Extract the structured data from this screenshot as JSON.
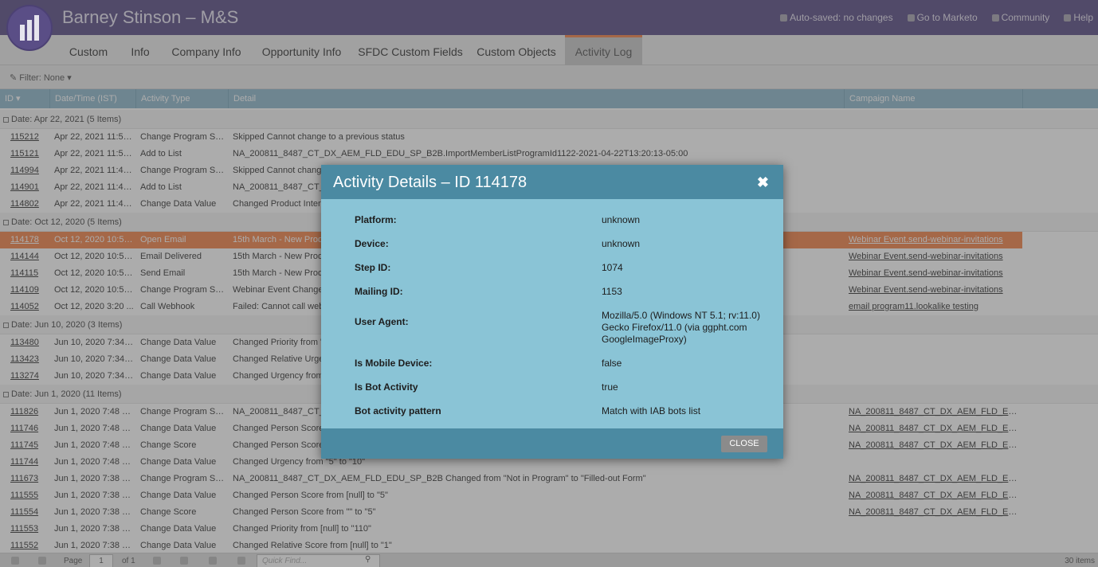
{
  "header": {
    "title": "Barney Stinson – M&S",
    "links": [
      "Auto-saved: no changes",
      "Go to Marketo",
      "Community",
      "Help"
    ]
  },
  "tabs": [
    "Custom",
    "Info",
    "Company Info",
    "Opportunity Info",
    "SFDC Custom Fields",
    "Custom Objects",
    "Activity Log"
  ],
  "active_tab": "Activity Log",
  "filter": "Filter: None",
  "grid": {
    "columns": [
      "ID",
      "Date/Time (IST)",
      "Activity Type",
      "Detail",
      "Campaign Name"
    ],
    "groups": [
      {
        "label": "Date: Apr 22, 2021 (5 Items)",
        "rows": [
          {
            "id": "115212",
            "dt": "Apr 22, 2021 11:50...",
            "type": "Change Program Sta...",
            "detail": "Skipped Cannot change to a previous status",
            "campaign": ""
          },
          {
            "id": "115121",
            "dt": "Apr 22, 2021 11:50...",
            "type": "Add to List",
            "detail": "NA_200811_8487_CT_DX_AEM_FLD_EDU_SP_B2B.ImportMemberListProgramId1122-2021-04-22T13:20:13-05:00",
            "campaign": ""
          },
          {
            "id": "114994",
            "dt": "Apr 22, 2021 11:45...",
            "type": "Change Program Sta...",
            "detail": "Skipped Cannot change",
            "campaign": ""
          },
          {
            "id": "114901",
            "dt": "Apr 22, 2021 11:45...",
            "type": "Add to List",
            "detail": "NA_200811_8487_CT_DX",
            "campaign": ""
          },
          {
            "id": "114802",
            "dt": "Apr 22, 2021 11:45...",
            "type": "Change Data Value",
            "detail": "Changed Product Intere",
            "campaign": ""
          }
        ]
      },
      {
        "label": "Date: Oct 12, 2020 (5 Items)",
        "rows": [
          {
            "id": "114178",
            "dt": "Oct 12, 2020 10:53...",
            "type": "Open Email",
            "detail": "15th March - New Prod",
            "campaign": "Webinar Event.send-webinar-invitations",
            "highlight": true
          },
          {
            "id": "114144",
            "dt": "Oct 12, 2020 10:52...",
            "type": "Email Delivered",
            "detail": "15th March - New Produ",
            "campaign": "Webinar Event.send-webinar-invitations"
          },
          {
            "id": "114115",
            "dt": "Oct 12, 2020 10:52...",
            "type": "Send Email",
            "detail": "15th March - New Produ",
            "campaign": "Webinar Event.send-webinar-invitations"
          },
          {
            "id": "114109",
            "dt": "Oct 12, 2020 10:52...",
            "type": "Change Program Sta...",
            "detail": "Webinar Event Changed",
            "campaign": "Webinar Event.send-webinar-invitations"
          },
          {
            "id": "114052",
            "dt": "Oct 12, 2020 3:20 ...",
            "type": "Call Webhook",
            "detail": "Failed: Cannot call webh",
            "campaign": "email program11.lookalike testing"
          }
        ]
      },
      {
        "label": "Date: Jun 10, 2020 (3 Items)",
        "rows": [
          {
            "id": "113480",
            "dt": "Jun 10, 2020 7:34 ...",
            "type": "Change Data Value",
            "detail": "Changed Priority from \"",
            "campaign": ""
          },
          {
            "id": "113423",
            "dt": "Jun 10, 2020 7:34 ...",
            "type": "Change Data Value",
            "detail": "Changed Relative Urgen",
            "campaign": ""
          },
          {
            "id": "113274",
            "dt": "Jun 10, 2020 7:34 ...",
            "type": "Change Data Value",
            "detail": "Changed Urgency from",
            "campaign": ""
          }
        ]
      },
      {
        "label": "Date: Jun 1, 2020 (11 Items)",
        "rows": [
          {
            "id": "111826",
            "dt": "Jun 1, 2020 7:48 PM",
            "type": "Change Program Sta...",
            "detail": "NA_200811_8487_CT_DX",
            "campaign": "NA_200811_8487_CT_DX_AEM_FLD_EDU_SP..."
          },
          {
            "id": "111746",
            "dt": "Jun 1, 2020 7:48 PM",
            "type": "Change Data Value",
            "detail": "Changed Person Score f",
            "campaign": "NA_200811_8487_CT_DX_AEM_FLD_EDU_SP..."
          },
          {
            "id": "111745",
            "dt": "Jun 1, 2020 7:48 PM",
            "type": "Change Score",
            "detail": "Changed Person Score f",
            "campaign": "NA_200811_8487_CT_DX_AEM_FLD_EDU_SP..."
          },
          {
            "id": "111744",
            "dt": "Jun 1, 2020 7:48 PM",
            "type": "Change Data Value",
            "detail": "Changed Urgency from \"5\" to \"10\"",
            "campaign": ""
          },
          {
            "id": "111673",
            "dt": "Jun 1, 2020 7:38 PM",
            "type": "Change Program Sta...",
            "detail": "NA_200811_8487_CT_DX_AEM_FLD_EDU_SP_B2B Changed from \"Not in Program\" to \"Filled-out Form\"",
            "campaign": "NA_200811_8487_CT_DX_AEM_FLD_EDU_SP..."
          },
          {
            "id": "111555",
            "dt": "Jun 1, 2020 7:38 PM",
            "type": "Change Data Value",
            "detail": "Changed Person Score from [null] to \"5\"",
            "campaign": "NA_200811_8487_CT_DX_AEM_FLD_EDU_SP..."
          },
          {
            "id": "111554",
            "dt": "Jun 1, 2020 7:38 PM",
            "type": "Change Score",
            "detail": "Changed Person Score from \"\" to \"5\"",
            "campaign": "NA_200811_8487_CT_DX_AEM_FLD_EDU_SP..."
          },
          {
            "id": "111553",
            "dt": "Jun 1, 2020 7:38 PM",
            "type": "Change Data Value",
            "detail": "Changed Priority from [null] to \"110\"",
            "campaign": ""
          },
          {
            "id": "111552",
            "dt": "Jun 1, 2020 7:38 PM",
            "type": "Change Data Value",
            "detail": "Changed Relative Score from [null] to \"1\"",
            "campaign": ""
          }
        ]
      }
    ]
  },
  "footer": {
    "page_label": "Page",
    "page_value": "1",
    "of_label": "of 1",
    "quick_find_placeholder": "Quick Find...",
    "items_count": "30 items"
  },
  "modal": {
    "title": "Activity Details – ID 114178",
    "fields": [
      {
        "key": "Platform:",
        "value": "unknown"
      },
      {
        "key": "Device:",
        "value": "unknown"
      },
      {
        "key": "Step ID:",
        "value": "1074"
      },
      {
        "key": "Mailing ID:",
        "value": "1153"
      },
      {
        "key": "User Agent:",
        "value": "Mozilla/5.0 (Windows NT 5.1; rv:11.0) Gecko Firefox/11.0 (via ggpht.com GoogleImageProxy)"
      },
      {
        "key": "Is Mobile Device:",
        "value": "false"
      },
      {
        "key": "Is Bot Activity",
        "value": "true"
      },
      {
        "key": "Bot activity pattern",
        "value": "Match with IAB bots list"
      }
    ],
    "close_label": "CLOSE"
  }
}
